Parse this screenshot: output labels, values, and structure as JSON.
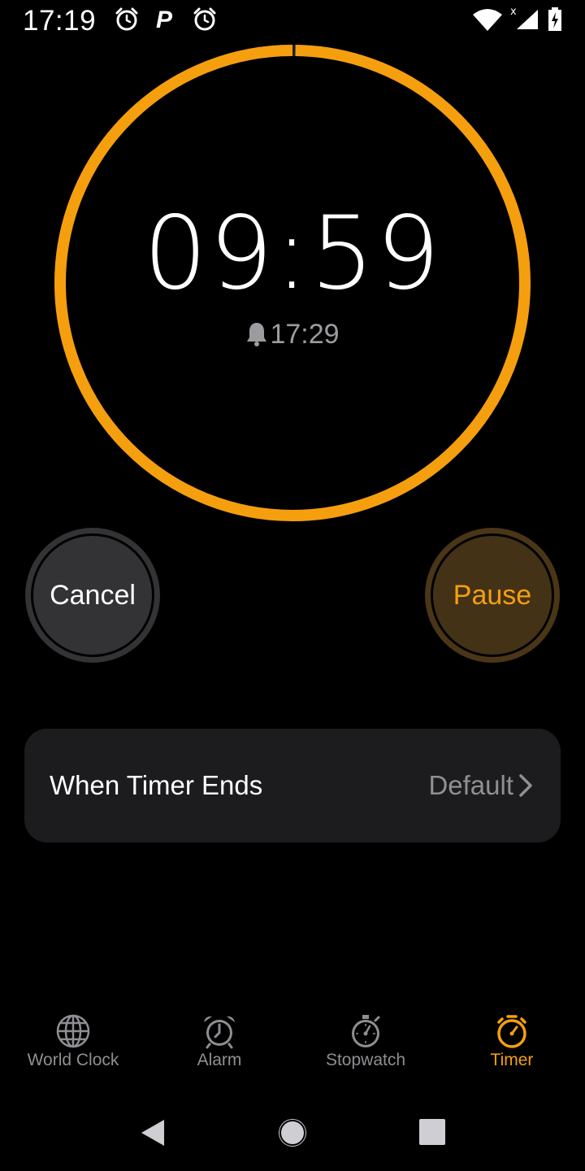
{
  "status_bar": {
    "time": "17:19",
    "icons": [
      "alarm-clock-icon",
      "p-icon",
      "alarm-clock-icon",
      "wifi-icon",
      "signal-icon",
      "battery-charging-icon"
    ],
    "p_label": "P"
  },
  "timer": {
    "remaining": "09:59",
    "end_time": "17:29",
    "progress_fraction": 0.998,
    "ring_color": "#f59f0f"
  },
  "buttons": {
    "cancel_label": "Cancel",
    "pause_label": "Pause"
  },
  "settings": {
    "when_timer_ends_label": "When Timer Ends",
    "when_timer_ends_value": "Default"
  },
  "tabs": [
    {
      "label": "World Clock",
      "icon": "globe-icon",
      "active": false
    },
    {
      "label": "Alarm",
      "icon": "alarm-clock-icon",
      "active": false
    },
    {
      "label": "Stopwatch",
      "icon": "stopwatch-icon",
      "active": false
    },
    {
      "label": "Timer",
      "icon": "timer-icon",
      "active": true
    }
  ],
  "colors": {
    "accent": "#f59f0f",
    "background": "#000000",
    "card": "#1c1c1e",
    "inactive": "#8e8e93"
  }
}
